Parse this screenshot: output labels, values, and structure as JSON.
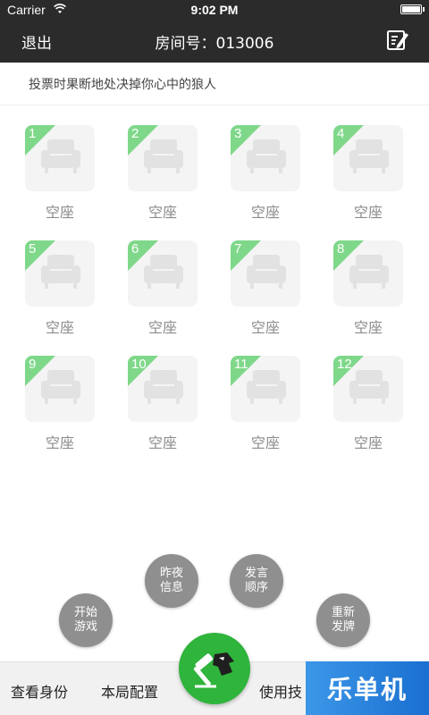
{
  "status_bar": {
    "carrier": "Carrier",
    "time": "9:02 PM"
  },
  "nav": {
    "exit_label": "退出",
    "title": "房间号：013006",
    "edit_icon": "edit-icon"
  },
  "hint": {
    "text": "投票时果断地处决掉你心中的狼人"
  },
  "seats": [
    {
      "number": "1",
      "label": "空座"
    },
    {
      "number": "2",
      "label": "空座"
    },
    {
      "number": "3",
      "label": "空座"
    },
    {
      "number": "4",
      "label": "空座"
    },
    {
      "number": "5",
      "label": "空座"
    },
    {
      "number": "6",
      "label": "空座"
    },
    {
      "number": "7",
      "label": "空座"
    },
    {
      "number": "8",
      "label": "空座"
    },
    {
      "number": "9",
      "label": "空座"
    },
    {
      "number": "10",
      "label": "空座"
    },
    {
      "number": "11",
      "label": "空座"
    },
    {
      "number": "12",
      "label": "空座"
    }
  ],
  "actions": {
    "start_game": [
      "开始",
      "游戏"
    ],
    "last_night": [
      "昨夜",
      "信息"
    ],
    "speak_order": [
      "发言",
      "顺序"
    ],
    "redeal": [
      "重新",
      "发牌"
    ]
  },
  "bottom_bar": {
    "view_identity": "查看身份",
    "game_config": "本局配置",
    "use_skill": "使用技"
  },
  "watermark": "乐单机",
  "colors": {
    "header_bg": "#2b2b2b",
    "seat_corner": "#7fd88a",
    "center_button": "#2fb43c",
    "fab_bg": "#8f8f8f",
    "watermark_bg": "#1a6fd0"
  }
}
